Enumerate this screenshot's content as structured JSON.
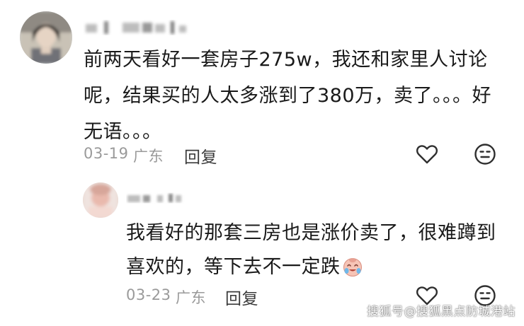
{
  "comment": {
    "text": "前两天看好一套房子275w，我还和家里人讨论呢，结果买的人太多涨到了380万，卖了。。。好无语。。。",
    "date": "03-19",
    "region": "广东",
    "reply_label": "回复"
  },
  "reply": {
    "text": "我看好的那套三房也是涨价卖了，很难蹲到喜欢的，等下去不一定跌",
    "date": "03-23",
    "region": "广东",
    "reply_label": "回复"
  },
  "icons": {
    "like": "heart-outline-icon",
    "dislike": "neutral-face-icon",
    "emoji": "crying-laughing-emoji"
  },
  "watermark": "搜狐号@搜狐黑点防城港站"
}
